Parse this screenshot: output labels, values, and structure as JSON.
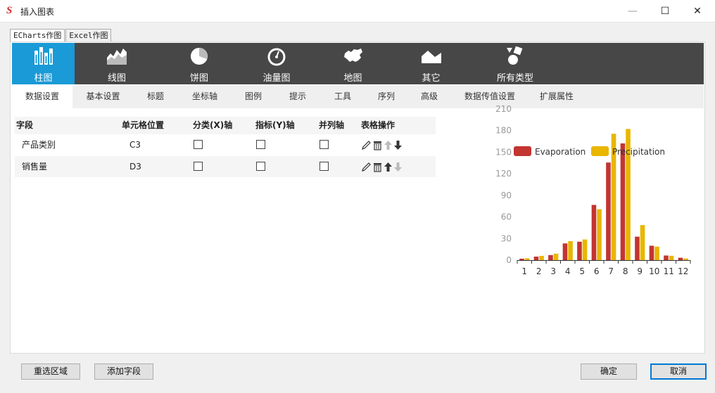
{
  "window": {
    "logo": "S",
    "title": "插入图表",
    "minimize_glyph": "—",
    "maximize_glyph": "☐",
    "close_glyph": "✕"
  },
  "outer_tabs": [
    {
      "label": "ECharts作图",
      "active": true
    },
    {
      "label": "Excel作图",
      "active": false
    }
  ],
  "chart_types": [
    {
      "label": "柱图",
      "icon": "bar-chart-icon",
      "active": true
    },
    {
      "label": "线图",
      "icon": "line-chart-icon",
      "active": false
    },
    {
      "label": "饼图",
      "icon": "pie-chart-icon",
      "active": false
    },
    {
      "label": "油量图",
      "icon": "gauge-icon",
      "active": false
    },
    {
      "label": "地图",
      "icon": "map-icon",
      "active": false
    },
    {
      "label": "其它",
      "icon": "area-shape-icon",
      "active": false
    },
    {
      "label": "所有类型",
      "icon": "shapes-icon",
      "active": false
    }
  ],
  "sub_tabs": [
    {
      "label": "数据设置",
      "active": true
    },
    {
      "label": "基本设置"
    },
    {
      "label": "标题"
    },
    {
      "label": "坐标轴"
    },
    {
      "label": "图例"
    },
    {
      "label": "提示"
    },
    {
      "label": "工具"
    },
    {
      "label": "序列"
    },
    {
      "label": "高级"
    },
    {
      "label": "数据传值设置"
    },
    {
      "label": "扩展属性"
    }
  ],
  "grid": {
    "headers": [
      "字段",
      "单元格位置",
      "分类(X)轴",
      "指标(Y)轴",
      "并列轴",
      "表格操作"
    ],
    "rows": [
      {
        "field": "产品类别",
        "cell": "C3",
        "x_axis": false,
        "y_axis": false,
        "parallel": false,
        "up_enabled": false,
        "down_enabled": true
      },
      {
        "field": "销售量",
        "cell": "D3",
        "x_axis": false,
        "y_axis": false,
        "parallel": false,
        "up_enabled": true,
        "down_enabled": false
      }
    ]
  },
  "chart_data": {
    "type": "bar",
    "x": [
      "1",
      "2",
      "3",
      "4",
      "5",
      "6",
      "7",
      "8",
      "9",
      "10",
      "11",
      "12"
    ],
    "series": [
      {
        "name": "Evaporation",
        "color": "#c23531",
        "values": [
          2.0,
          4.9,
          7.0,
          23.2,
          25.6,
          76.7,
          135.6,
          162.2,
          32.6,
          20.0,
          6.4,
          3.3
        ]
      },
      {
        "name": "Precipitation",
        "color": "#e9b600",
        "values": [
          2.6,
          5.9,
          9.0,
          26.4,
          28.7,
          70.7,
          175.6,
          182.2,
          48.7,
          18.8,
          6.0,
          2.3
        ]
      }
    ],
    "y_ticks": [
      "0",
      "30",
      "60",
      "90",
      "120",
      "150",
      "180",
      "210"
    ],
    "ylim": [
      0,
      210
    ],
    "legend_position": "top",
    "grid": false
  },
  "buttons": {
    "reselect": "重选区域",
    "add_field": "添加字段",
    "ok": "确定",
    "cancel": "取消"
  }
}
